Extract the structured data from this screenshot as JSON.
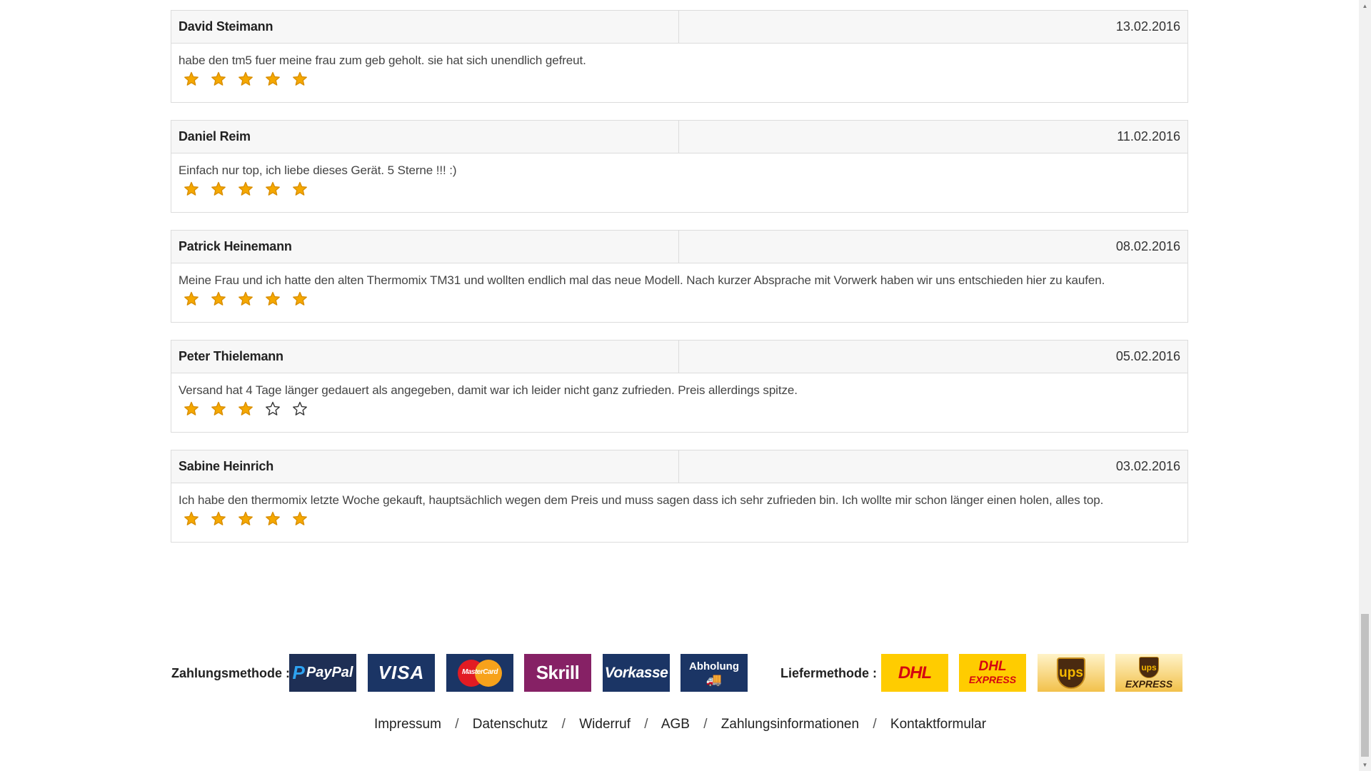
{
  "reviews": [
    {
      "author": "David Steimann",
      "date": "13.02.2016",
      "text": "habe den tm5 fuer meine frau zum geb geholt. sie hat sich unendlich gefreut.",
      "rating": 5
    },
    {
      "author": "Daniel Reim",
      "date": "11.02.2016",
      "text": "Einfach nur top, ich liebe dieses Gerät. 5 Sterne !!! :)",
      "rating": 5
    },
    {
      "author": "Patrick Heinemann",
      "date": "08.02.2016",
      "text": "Meine Frau und ich hatte den alten Thermomix TM31 und wollten endlich mal das neue Modell. Nach kurzer Absprache mit Vorwerk haben wir uns entschieden hier zu kaufen.",
      "rating": 5
    },
    {
      "author": "Peter Thielemann",
      "date": "05.02.2016",
      "text": "Versand hat 4 Tage länger gedauert als angegeben, damit war ich leider nicht ganz zufrieden. Preis allerdings spitze.",
      "rating": 3
    },
    {
      "author": "Sabine Heinrich",
      "date": "03.02.2016",
      "text": "Ich habe den thermomix letzte Woche gekauft, hauptsächlich wegen dem Preis und muss sagen dass ich sehr zufrieden bin. Ich wollte mir schon länger einen holen, alles top.",
      "rating": 5
    }
  ],
  "payment": {
    "label": "Zahlungsmethode :",
    "methods": {
      "paypal_p": "P",
      "paypal": "PayPal",
      "visa": "VISA",
      "mastercard": "MasterCard",
      "skrill": "Skrill",
      "vorkasse": "Vorkasse",
      "abholung": "Abholung"
    }
  },
  "shipping": {
    "label": "Liefermethode :",
    "methods": {
      "dhl": "DHL",
      "dhl_express_top": "DHL",
      "dhl_express_bottom": "EXPRESS",
      "ups": "ups",
      "ups_express_shield": "ups",
      "ups_express_text": "EXPRESS"
    }
  },
  "footer": {
    "links": [
      "Impressum",
      "Datenschutz",
      "Widerruf",
      "AGB",
      "Zahlungsinformationen",
      "Kontaktformular"
    ],
    "separator": "/"
  },
  "colors": {
    "star_filled": "#f5a800",
    "star_empty_stroke": "#333333",
    "border": "#dcdcdc"
  }
}
